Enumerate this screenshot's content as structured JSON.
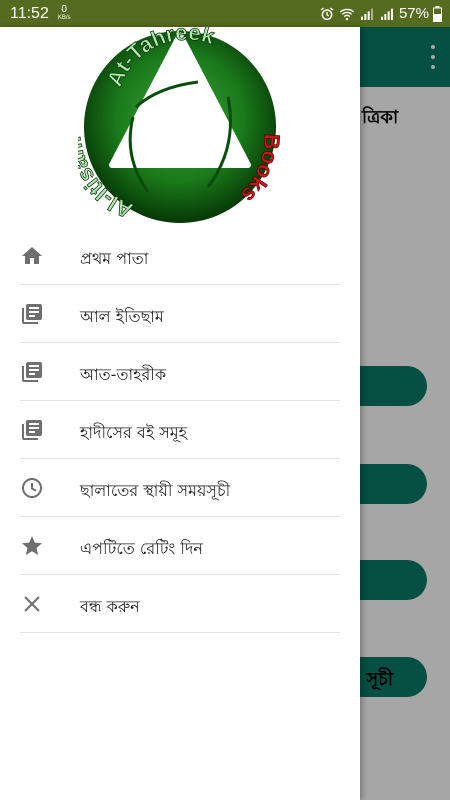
{
  "status_bar": {
    "time": "11:52",
    "net_speed_value": "0",
    "net_speed_unit": "KB/s",
    "battery_percent": "57%",
    "bar_color": "#556b1f"
  },
  "app": {
    "accent": "#0a7a68",
    "header_text": "ত্রিকা",
    "last_pill_text": "সূচী"
  },
  "drawer": {
    "logo": {
      "top_text": "At-Tahreek",
      "left_text": "Al-Itisam",
      "right_text": "Books"
    },
    "items": [
      {
        "label": "প্রথম পাতা",
        "icon": "home-icon"
      },
      {
        "label": "আল ইতিছাম",
        "icon": "article-icon"
      },
      {
        "label": "আত-তাহরীক",
        "icon": "article-icon"
      },
      {
        "label": "হাদীসের বই সমূহ",
        "icon": "article-icon"
      },
      {
        "label": "ছালাতের স্থায়ী সময়সূচী",
        "icon": "clock-icon"
      },
      {
        "label": "এপটিতে রেটিং দিন",
        "icon": "star-icon"
      },
      {
        "label": "বন্ধ করুন",
        "icon": "close-icon"
      }
    ]
  }
}
